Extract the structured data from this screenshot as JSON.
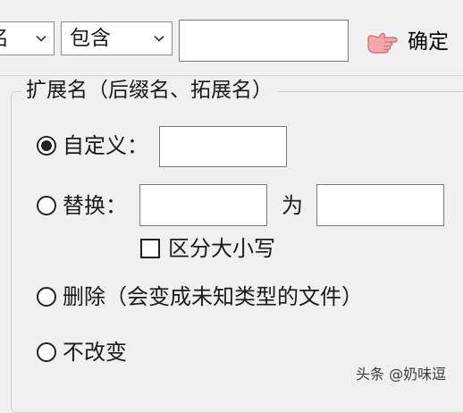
{
  "toolbar": {
    "field_combo_value": "名",
    "condition_combo_value": "包含",
    "keyword_value": "",
    "ok_button_label": "确定"
  },
  "extension_group": {
    "title": "扩展名（后缀名、拓展名）",
    "custom": {
      "label": "自定义：",
      "checked": true,
      "value": ""
    },
    "replace": {
      "label": "替换：",
      "checked": false,
      "from_value": "",
      "to_label": "为",
      "to_value": "",
      "case_sensitive_label": "区分大小写",
      "case_sensitive_checked": false
    },
    "delete": {
      "label": "删除（会变成未知类型的文件）",
      "checked": false
    },
    "no_change": {
      "label": "不改变",
      "checked": false
    }
  },
  "watermark": "头条 @奶味逗",
  "icons": {
    "ok_button_icon": "pointing-hand-icon",
    "combo_arrow_icon": "chevron-down-icon"
  },
  "colors": {
    "background": "#f0f0f0",
    "input_border": "#7a7a7a",
    "hand_icon_fill": "#f4a6ad"
  }
}
